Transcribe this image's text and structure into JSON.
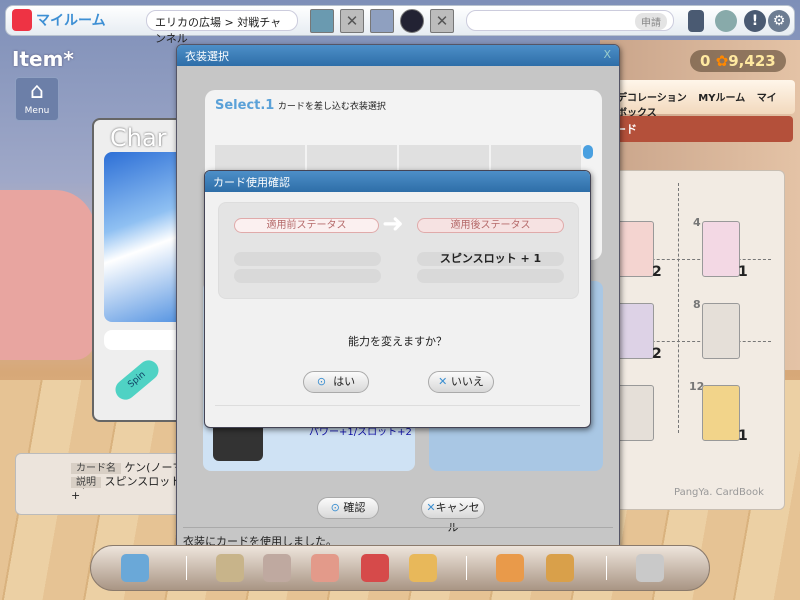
{
  "topbar": {
    "title": "マイルーム",
    "breadcrumb": "エリカの広場 > 対戦チャンネル",
    "apply_button": "申請"
  },
  "left": {
    "item_title": "Item*",
    "menu_label": "Menu",
    "char_title": "Char",
    "spin_label": "Spin",
    "card_info": {
      "name_label": "カード名",
      "name_value": "ケン(ノーマル)",
      "desc_label": "説明",
      "desc_value": "スピンスロット+"
    }
  },
  "right": {
    "coins_a": "0",
    "coins_b": "9,423",
    "menu": [
      "デコレーション",
      "MYルーム",
      "マイボックス"
    ],
    "red_tab": "ード",
    "card_book_label": "PangYa. CardBook",
    "cards": [
      {
        "num": "",
        "count": "2"
      },
      {
        "num": "4",
        "count": "1"
      },
      {
        "num": "",
        "count": "2"
      },
      {
        "num": "8",
        "count": ""
      },
      {
        "num": "",
        "count": ""
      },
      {
        "num": "12",
        "count": "1"
      }
    ]
  },
  "outfit_dialog": {
    "title": "衣装選択",
    "close": "X",
    "select_title": "Select.1",
    "select_sub": "カードを差し込む衣装選択",
    "outfit_stat": "パワー+1/スロット+2",
    "confirm": "確認",
    "cancel": "キャンセル",
    "status": "衣装にカードを使用しました。"
  },
  "card_dialog": {
    "title": "カード使用確認",
    "before_label": "適用前ステータス",
    "after_label": "適用後ステータス",
    "after_value": "スピンスロット + 1",
    "question": "能力を変えますか？",
    "yes": "はい",
    "no": "いいえ"
  },
  "colors": {
    "accent": "#3d8fd4",
    "header": "#2e6ea8"
  }
}
